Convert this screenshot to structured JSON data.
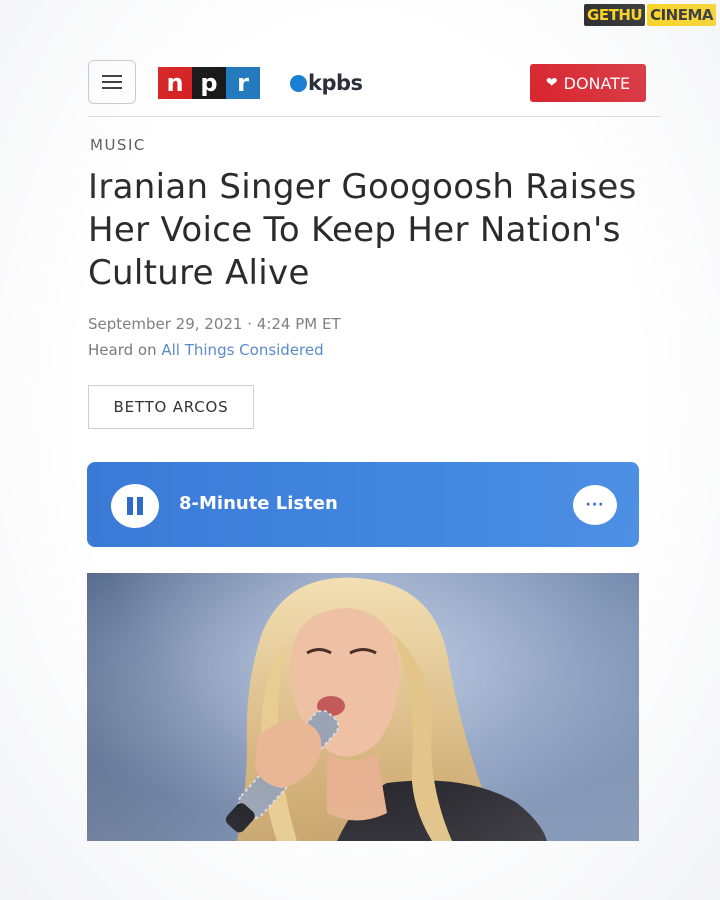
{
  "watermark": {
    "left": "GETHU",
    "right": "CINEMA"
  },
  "header": {
    "logo_npr": [
      "n",
      "p",
      "r"
    ],
    "logo_station": "kpbs",
    "donate_label": "DONATE"
  },
  "article": {
    "section": "MUSIC",
    "headline": "Iranian Singer Googoosh Raises Her Voice To Keep Her Nation's Culture Alive",
    "date": "September 29, 2021 · 4:24 PM ET",
    "heard_on_prefix": "Heard on ",
    "heard_on_program": "All Things Considered",
    "byline": "BETTO ARCOS"
  },
  "player": {
    "label": "8-Minute Listen",
    "more_label": "···"
  },
  "colors": {
    "npr_red": "#d62021",
    "npr_black": "#1a1a1a",
    "npr_blue": "#237bbd",
    "donate": "#d9252f",
    "player": "#4287e0",
    "link": "#5a8bc9"
  },
  "icons": {
    "menu": "hamburger-icon",
    "donate": "heart-icon",
    "play_state": "pause-icon",
    "more": "ellipsis-icon"
  }
}
